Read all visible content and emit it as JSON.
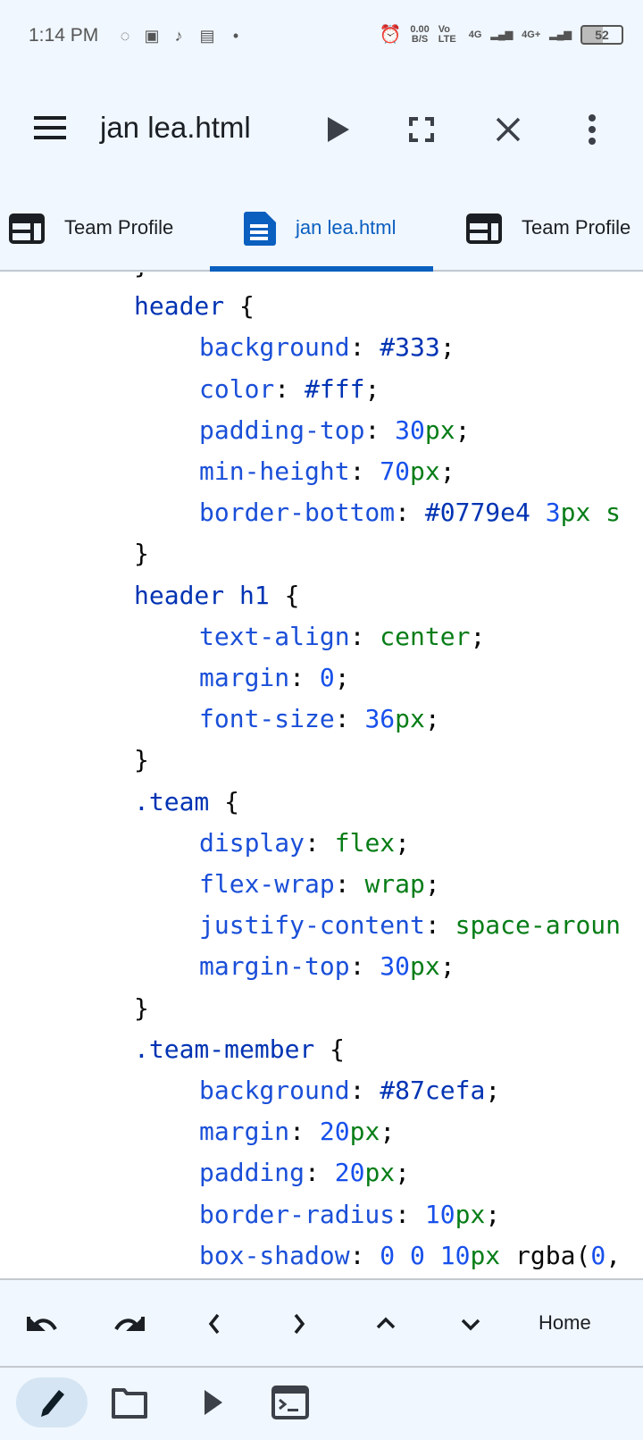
{
  "status_bar": {
    "time": "1:14 PM",
    "net_speed": "0.00",
    "net_unit": "B/S",
    "volte": "Vo LTE",
    "sim1": "4G",
    "sim2": "4G+",
    "battery": "52"
  },
  "app_bar": {
    "title": "jan lea.html"
  },
  "tabs": [
    {
      "label": "Team Profile",
      "icon": "web-layout-icon",
      "active": false
    },
    {
      "label": "jan lea.html",
      "icon": "document-icon",
      "active": true
    },
    {
      "label": "Team Profile",
      "icon": "web-layout-icon",
      "active": false
    }
  ],
  "colors": {
    "accent": "#0b5fbf",
    "selector": "#0033b3",
    "property": "#1a4fd8",
    "number": "#1750eb",
    "keyword": "#067d17",
    "background": "#f0f7fe"
  },
  "code_lines": [
    {
      "indent": 1,
      "tokens": [
        [
          "}",
          "p"
        ]
      ]
    },
    {
      "indent": 1,
      "tokens": [
        [
          "header",
          "sel"
        ],
        [
          " {",
          "p"
        ]
      ]
    },
    {
      "indent": 2,
      "tokens": [
        [
          "background",
          "prop"
        ],
        [
          ": ",
          "p"
        ],
        [
          "#333",
          "hex"
        ],
        [
          ";",
          "p"
        ]
      ]
    },
    {
      "indent": 2,
      "tokens": [
        [
          "color",
          "prop"
        ],
        [
          ": ",
          "p"
        ],
        [
          "#fff",
          "hex"
        ],
        [
          ";",
          "p"
        ]
      ]
    },
    {
      "indent": 2,
      "tokens": [
        [
          "padding-top",
          "prop"
        ],
        [
          ": ",
          "p"
        ],
        [
          "30",
          "num"
        ],
        [
          "px",
          "kw"
        ],
        [
          ";",
          "p"
        ]
      ]
    },
    {
      "indent": 2,
      "tokens": [
        [
          "min-height",
          "prop"
        ],
        [
          ": ",
          "p"
        ],
        [
          "70",
          "num"
        ],
        [
          "px",
          "kw"
        ],
        [
          ";",
          "p"
        ]
      ]
    },
    {
      "indent": 2,
      "tokens": [
        [
          "border-bottom",
          "prop"
        ],
        [
          ": ",
          "p"
        ],
        [
          "#0779e4",
          "hex"
        ],
        [
          " ",
          "p"
        ],
        [
          "3",
          "num"
        ],
        [
          "px",
          "kw"
        ],
        [
          " s",
          "kw"
        ]
      ]
    },
    {
      "indent": 1,
      "tokens": [
        [
          "}",
          "p"
        ]
      ]
    },
    {
      "indent": 1,
      "tokens": [
        [
          "header h1",
          "sel"
        ],
        [
          " {",
          "p"
        ]
      ]
    },
    {
      "indent": 2,
      "tokens": [
        [
          "text-align",
          "prop"
        ],
        [
          ": ",
          "p"
        ],
        [
          "center",
          "kw"
        ],
        [
          ";",
          "p"
        ]
      ]
    },
    {
      "indent": 2,
      "tokens": [
        [
          "margin",
          "prop"
        ],
        [
          ": ",
          "p"
        ],
        [
          "0",
          "num"
        ],
        [
          ";",
          "p"
        ]
      ]
    },
    {
      "indent": 2,
      "tokens": [
        [
          "font-size",
          "prop"
        ],
        [
          ": ",
          "p"
        ],
        [
          "36",
          "num"
        ],
        [
          "px",
          "kw"
        ],
        [
          ";",
          "p"
        ]
      ]
    },
    {
      "indent": 1,
      "tokens": [
        [
          "}",
          "p"
        ]
      ]
    },
    {
      "indent": 1,
      "tokens": [
        [
          ".team",
          "sel"
        ],
        [
          " {",
          "p"
        ]
      ]
    },
    {
      "indent": 2,
      "tokens": [
        [
          "display",
          "prop"
        ],
        [
          ": ",
          "p"
        ],
        [
          "flex",
          "kw"
        ],
        [
          ";",
          "p"
        ]
      ]
    },
    {
      "indent": 2,
      "tokens": [
        [
          "flex-wrap",
          "prop"
        ],
        [
          ": ",
          "p"
        ],
        [
          "wrap",
          "kw"
        ],
        [
          ";",
          "p"
        ]
      ]
    },
    {
      "indent": 2,
      "tokens": [
        [
          "justify-content",
          "prop"
        ],
        [
          ": ",
          "p"
        ],
        [
          "space-aroun",
          "kw"
        ]
      ]
    },
    {
      "indent": 2,
      "tokens": [
        [
          "margin-top",
          "prop"
        ],
        [
          ": ",
          "p"
        ],
        [
          "30",
          "num"
        ],
        [
          "px",
          "kw"
        ],
        [
          ";",
          "p"
        ]
      ]
    },
    {
      "indent": 1,
      "tokens": [
        [
          "}",
          "p"
        ]
      ]
    },
    {
      "indent": 1,
      "tokens": [
        [
          ".team-member",
          "sel"
        ],
        [
          " {",
          "p"
        ]
      ]
    },
    {
      "indent": 2,
      "tokens": [
        [
          "background",
          "prop"
        ],
        [
          ": ",
          "p"
        ],
        [
          "#87cefa",
          "hex"
        ],
        [
          ";",
          "p"
        ]
      ]
    },
    {
      "indent": 2,
      "tokens": [
        [
          "margin",
          "prop"
        ],
        [
          ": ",
          "p"
        ],
        [
          "20",
          "num"
        ],
        [
          "px",
          "kw"
        ],
        [
          ";",
          "p"
        ]
      ]
    },
    {
      "indent": 2,
      "tokens": [
        [
          "padding",
          "prop"
        ],
        [
          ": ",
          "p"
        ],
        [
          "20",
          "num"
        ],
        [
          "px",
          "kw"
        ],
        [
          ";",
          "p"
        ]
      ]
    },
    {
      "indent": 2,
      "tokens": [
        [
          "border-radius",
          "prop"
        ],
        [
          ": ",
          "p"
        ],
        [
          "10",
          "num"
        ],
        [
          "px",
          "kw"
        ],
        [
          ";",
          "p"
        ]
      ]
    },
    {
      "indent": 2,
      "tokens": [
        [
          "box-shadow",
          "prop"
        ],
        [
          ": ",
          "p"
        ],
        [
          "0",
          "num"
        ],
        [
          " ",
          "p"
        ],
        [
          "0",
          "num"
        ],
        [
          " ",
          "p"
        ],
        [
          "10",
          "num"
        ],
        [
          "px",
          "kw"
        ],
        [
          " rgba(",
          "p"
        ],
        [
          "0",
          "num"
        ],
        [
          ",",
          "p"
        ]
      ]
    }
  ],
  "toolbar": {
    "home_label": "Home"
  }
}
